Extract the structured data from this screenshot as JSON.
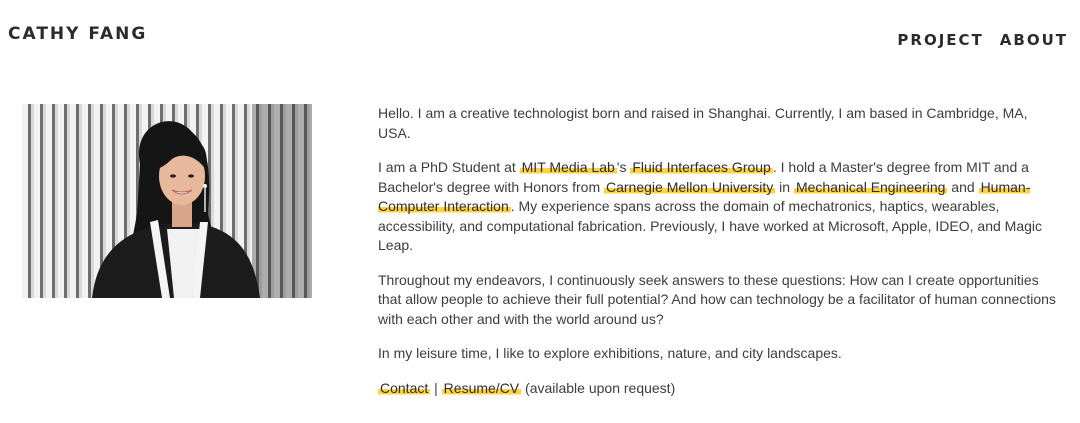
{
  "header": {
    "site_title": "CATHY FANG",
    "nav": {
      "project": "PROJECT",
      "about": "ABOUT"
    }
  },
  "about": {
    "intro": "Hello. I am a creative technologist born and raised in Shanghai. Currently, I am based in Cambridge, MA, USA.",
    "p2": {
      "t1": "I am a PhD Student at ",
      "link_media_lab": "MIT Media Lab",
      "t2": "'s ",
      "link_fluid": "Fluid Interfaces Group",
      "t3": ". I hold a Master's degree from MIT and a Bachelor's degree with Honors from ",
      "link_cmu": "Carnegie Mellon University",
      "t4": " in ",
      "link_mecheng": "Mechanical Engineering",
      "t5": " and ",
      "link_hci": "Human-Computer Interaction",
      "t6": ". My experience spans across the domain of mechatronics, haptics, wearables, accessibility, and computational fabrication. Previously, I have worked at Microsoft, Apple, IDEO, and Magic Leap."
    },
    "p3": "Throughout my endeavors, I continuously seek answers to these questions: How can I create opportunities that allow people to achieve their full potential? And how can technology be a facilitator of human connections with each other and with the world around us?",
    "p4": "In my leisure time, I like to explore exhibitions, nature, and city landscapes.",
    "links": {
      "contact": "Contact",
      "separator": " | ",
      "resume": "Resume/CV",
      "note": " (available upon request)"
    }
  },
  "colors": {
    "highlight": "#ffd23f",
    "text": "#3d3d3d"
  }
}
